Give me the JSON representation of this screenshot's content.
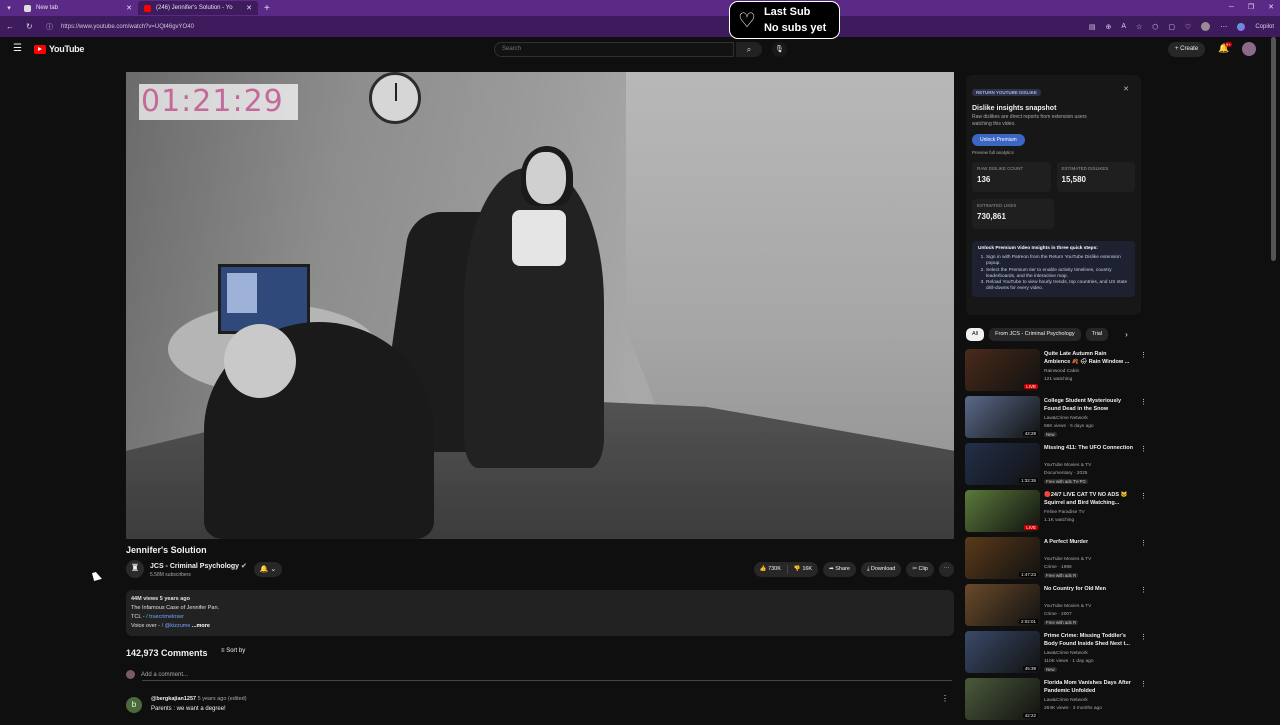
{
  "browser": {
    "tabs": [
      {
        "label": "New tab",
        "active": false
      },
      {
        "label": "(246) Jennifer's Solution - Yo",
        "active": true
      }
    ],
    "new_tab_glyph": "+",
    "url": "https://www.youtube.com/watch?v=UQt46gvYO40",
    "copilot_label": "Copilot"
  },
  "youtube": {
    "logo_text": "YouTube",
    "search_placeholder": "Search",
    "create_label": "Create",
    "notification_count": "9+"
  },
  "overlay": {
    "line1": "Last Sub",
    "line2": "No subs yet"
  },
  "video": {
    "timer": "01:21:29",
    "title": "Jennifer's Solution",
    "channel_name": "JCS - Criminal Psychology",
    "subscribers": "5.58M subscribers",
    "likes": "730K",
    "dislikes": "16K",
    "share_label": "Share",
    "download_label": "Download",
    "clip_label": "Clip"
  },
  "description": {
    "meta": "44M views  5 years ago",
    "line1": "The Infamous Case of Jennifer Pan.",
    "line2_prefix": "TCL - ",
    "line2_handle": "/ truecrimeloser",
    "line3_prefix": "Voice over - ",
    "line3_handle": "/ @kizzume",
    "more": "...more"
  },
  "comments": {
    "count_label": "142,973 Comments",
    "sort_label": "Sort by",
    "add_placeholder": "Add a comment...",
    "first": {
      "avatar_letter": "b",
      "author": "@bergkajian1257",
      "age": "5 years ago (edited)",
      "text": "Parents : we want a degree!"
    }
  },
  "ryd_panel": {
    "brand": "RETURN YOUTUBE DISLIKE",
    "heading": "Dislike insights snapshot",
    "subtitle": "Raw dislikes are direct reports from extension users watching this video.",
    "unlock_label": "Unlock Premium",
    "preview_label": "Preview full analytics",
    "raw_label": "RAW DISLIKE COUNT",
    "raw_value": "136",
    "est_dislikes_label": "ESTIMATED DISLIKES",
    "est_dislikes_value": "15,580",
    "est_likes_label": "ESTIMATED LIKES",
    "est_likes_value": "730,861",
    "steps_title": "Unlock Premium Video Insights in three quick steps:",
    "steps": [
      "Sign in with Patreon from the Return YouTube Dislike extension popup.",
      "Select the Premium tier to enable activity timelines, country leaderboards, and the interactive map.",
      "Reload YouTube to view hourly trends, top countries, and US state drill-downs for every video."
    ]
  },
  "chips": [
    "All",
    "From JCS - Criminal Psychology",
    "Trial"
  ],
  "recommendations": [
    {
      "title": "Quite Late Autumn Rain Ambience 🍂 🌧 Rain Window ...",
      "channel": "Rainwood Cabin",
      "meta": "121 watching",
      "badge": "",
      "duration": "LIVE",
      "live": true,
      "color": "#4a2b1a"
    },
    {
      "title": "College Student Mysteriously Found Dead in the Snow",
      "channel": "Law&Crime Network",
      "meta": "56K views · 5 days ago",
      "badge": "New",
      "duration": "42:29",
      "live": false,
      "color": "#5a6a8a"
    },
    {
      "title": "Missing 411: The UFO Connection",
      "channel": "YouTube Movies & TV",
      "meta": "Documentary · 2025",
      "badge": "Free with ads  TV-PG",
      "duration": "1:32:35",
      "live": false,
      "color": "#22304a"
    },
    {
      "title": "🔴24/7 LIVE CAT TV NO ADS 🐱 Squirrel and Bird Watching...",
      "channel": "Feline Paradise TV",
      "meta": "1.1K watching",
      "badge": "",
      "duration": "LIVE",
      "live": true,
      "color": "#5a7a3a"
    },
    {
      "title": "A Perfect Murder",
      "channel": "YouTube Movies & TV",
      "meta": "Crime · 1998",
      "badge": "Free with ads  R",
      "duration": "1:47:23",
      "live": false,
      "color": "#5a3a1a"
    },
    {
      "title": "No Country for Old Men",
      "channel": "YouTube Movies & TV",
      "meta": "Crime · 2007",
      "badge": "Free with ads  R",
      "duration": "2:02:01",
      "live": false,
      "color": "#6a4a2a"
    },
    {
      "title": "Prime Crime: Missing Toddler's Body Found Inside Shed Next t...",
      "channel": "Law&Crime Network",
      "meta": "110K views · 1 day ago",
      "badge": "New",
      "duration": "45:39",
      "live": false,
      "color": "#3a4a6a"
    },
    {
      "title": "Florida Mom Vanishes Days After Pandemic Unfolded",
      "channel": "Law&Crime Network",
      "meta": "264K views · 3 months ago",
      "badge": "",
      "duration": "42:22",
      "live": false,
      "color": "#4a5a3a"
    }
  ],
  "icons": {
    "hamburger": "menu-icon",
    "search": "search-icon",
    "mic": "mic-icon",
    "bell": "bell-icon",
    "heart": "heart-icon"
  }
}
